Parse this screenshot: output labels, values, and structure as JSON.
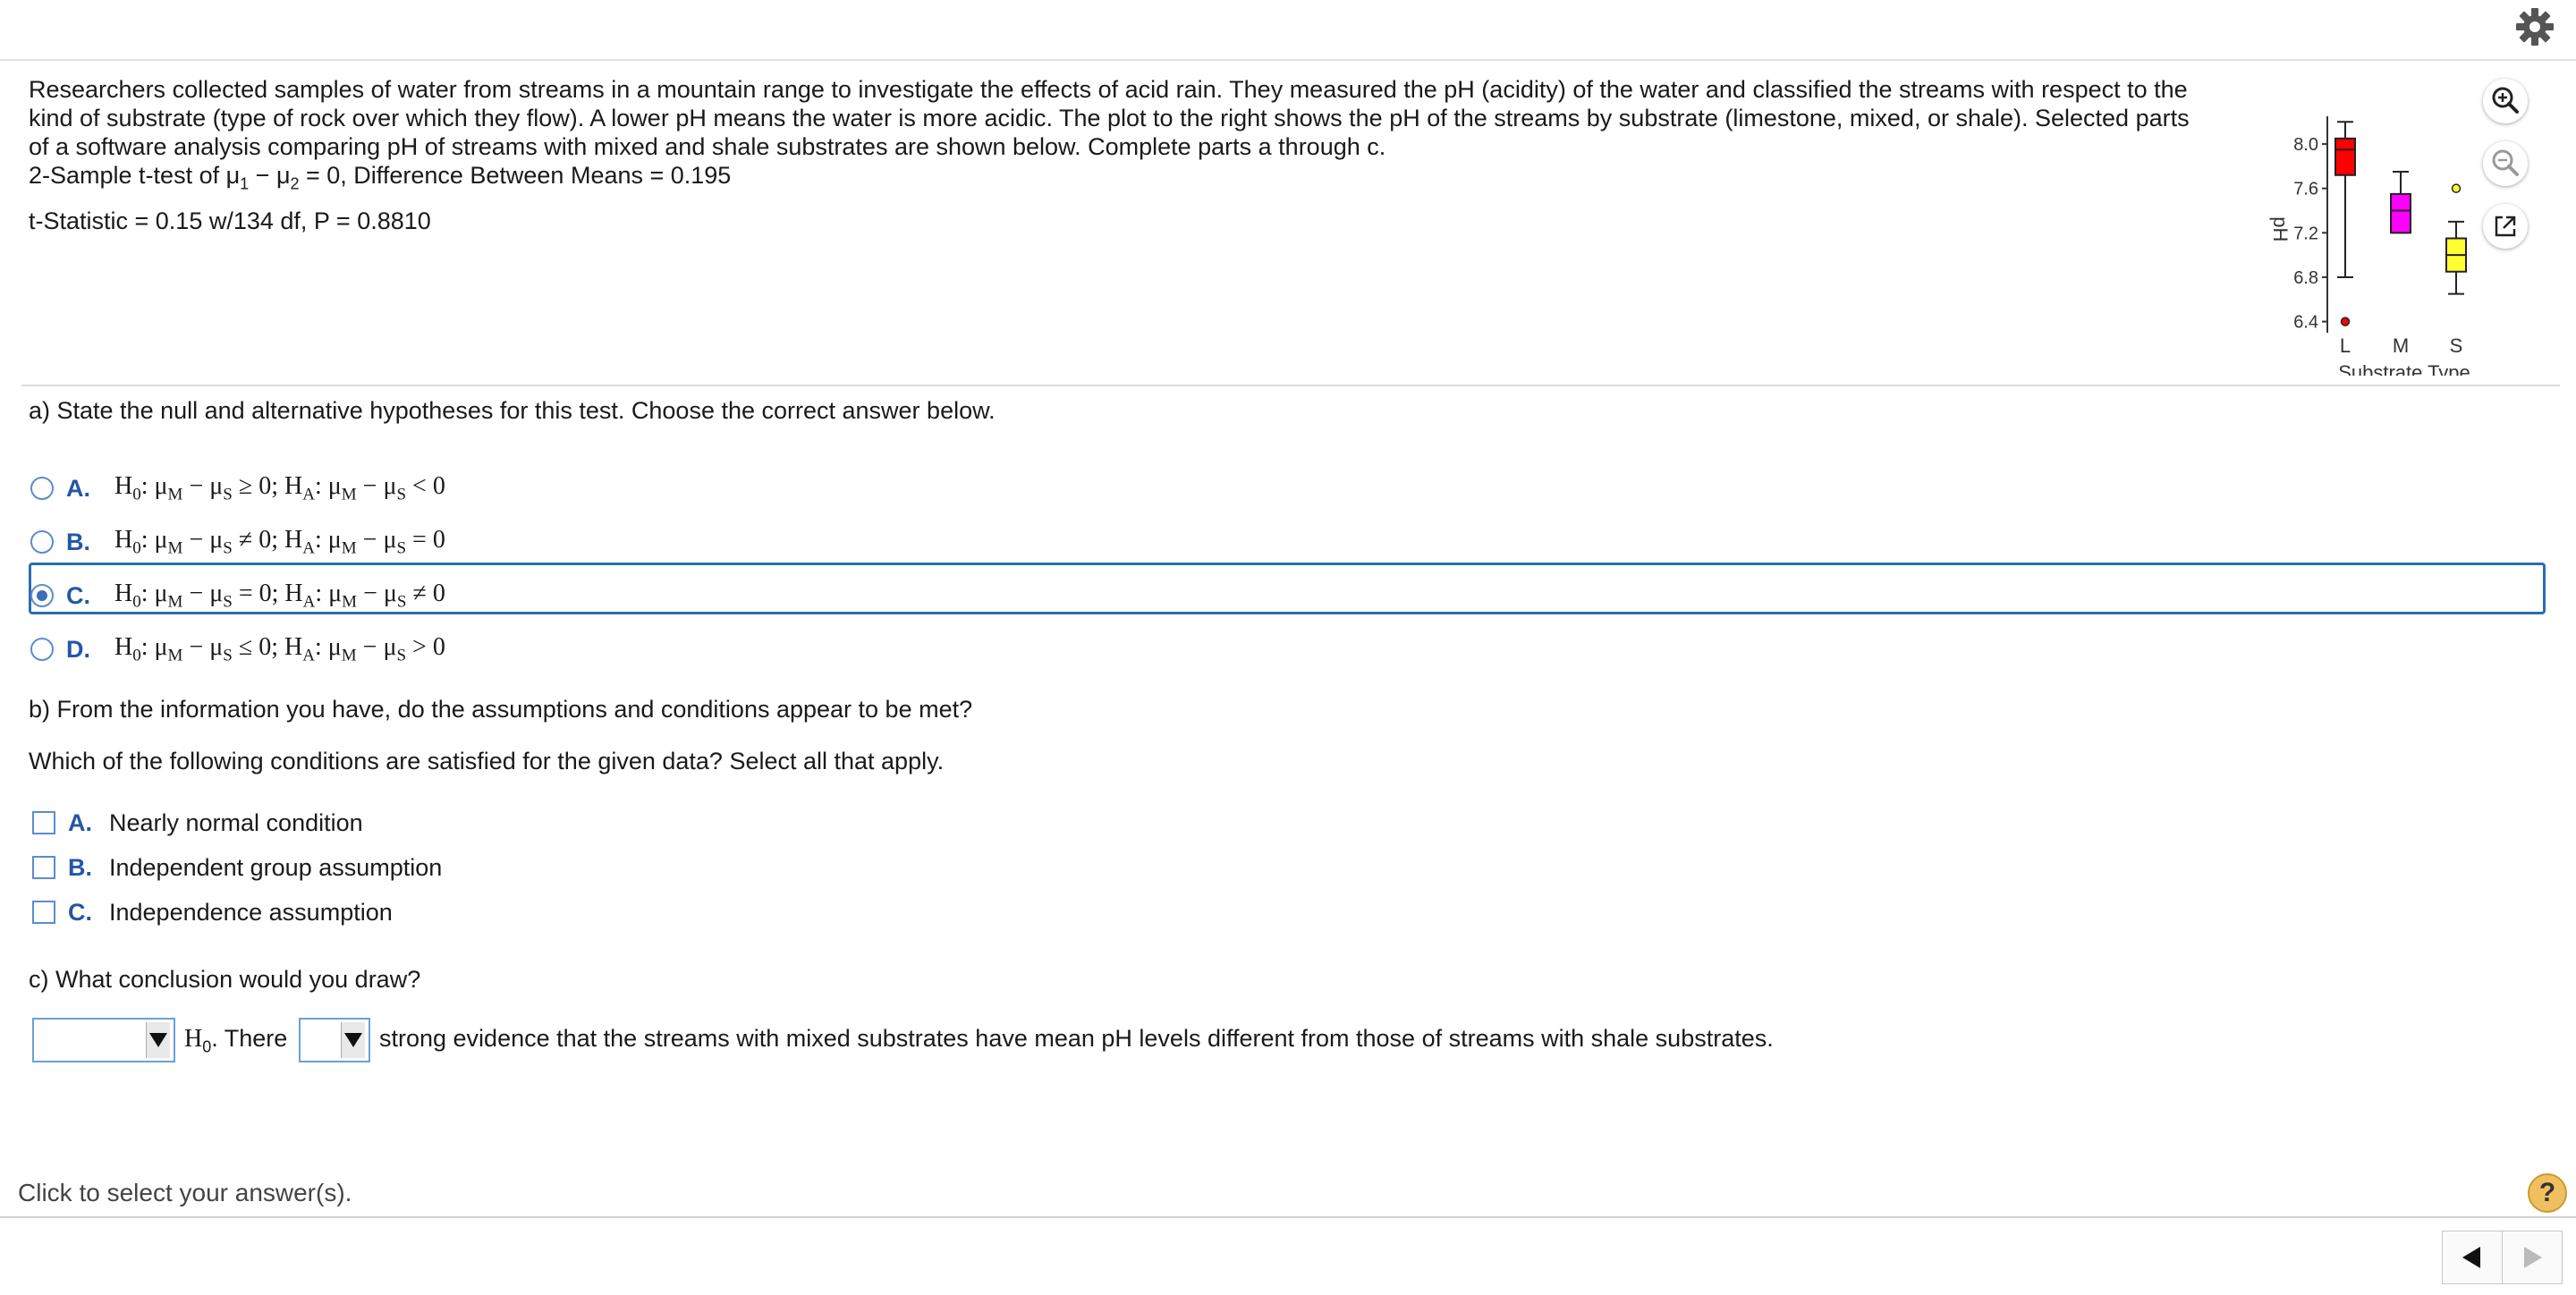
{
  "problem": {
    "paragraph": "Researchers collected samples of water from streams in a mountain range to investigate the effects of acid rain. They measured the pH (acidity) of the water and classified the streams with respect to the kind of substrate (type of rock over which they flow). A lower pH means the water is more acidic. The plot to the right shows the pH of the streams by substrate (limestone, mixed, or shale). Selected parts of a software analysis comparing pH of streams with mixed and shale substrates are shown below. Complete parts a through c.",
    "test_prefix": "2-Sample t-test of μ",
    "test_mid": " − μ",
    "test_suffix": " = 0,   Difference Between Means = 0.195",
    "sub1": "1",
    "sub2": "2",
    "stat_line": "t-Statistic = 0.15 w/134 df,   P = 0.8810"
  },
  "chart_data": {
    "type": "box",
    "xlabel": "Substrate Type",
    "ylabel": "pH",
    "categories": [
      "L",
      "M",
      "S"
    ],
    "yticks": [
      "8.0",
      "7.6",
      "7.2",
      "6.8",
      "6.4"
    ],
    "ylim": [
      6.3,
      8.25
    ],
    "series": [
      {
        "name": "L",
        "color": "#ff0000",
        "whisker_low": 6.8,
        "q1": 7.72,
        "median": 7.95,
        "q3": 8.05,
        "whisker_high": 8.2,
        "outliers": [
          6.4
        ]
      },
      {
        "name": "M",
        "color": "#ff00ff",
        "whisker_low": 7.2,
        "q1": 7.2,
        "median": 7.4,
        "q3": 7.55,
        "whisker_high": 7.75,
        "outliers": []
      },
      {
        "name": "S",
        "color": "#ffff33",
        "whisker_low": 6.65,
        "q1": 6.85,
        "median": 7.0,
        "q3": 7.15,
        "whisker_high": 7.3,
        "outliers": [
          7.6
        ]
      }
    ]
  },
  "part_a": {
    "question": "a) State the null and alternative hypotheses for this test. Choose the correct answer below.",
    "options": [
      {
        "letter": "A.",
        "h0_op": "≥ 0;",
        "ha_op": "< 0"
      },
      {
        "letter": "B.",
        "h0_op": "≠ 0;",
        "ha_op": "= 0"
      },
      {
        "letter": "C.",
        "h0_op": "= 0;",
        "ha_op": "≠ 0"
      },
      {
        "letter": "D.",
        "h0_op": "≤ 0;",
        "ha_op": "> 0"
      }
    ],
    "h_text": "H",
    "h0_sub": "0",
    "ha_sub": "A",
    "mu_text": ": μ",
    "m_sub": "M",
    "minus_mu": " − μ",
    "s_sub": "S",
    "selected": "C"
  },
  "part_b": {
    "question": "b) From the information you have, do the assumptions and conditions appear to be met?",
    "prompt": "Which of the following conditions are satisfied for the given data? Select all that apply.",
    "options": [
      {
        "letter": "A.",
        "label": "Nearly normal condition"
      },
      {
        "letter": "B.",
        "label": "Independent group assumption"
      },
      {
        "letter": "C.",
        "label": "Independence assumption"
      }
    ]
  },
  "part_c": {
    "question": "c) What conclusion would you draw?",
    "h_text": "H",
    "h_sub": "0",
    "mid_text": ". There",
    "tail_text": "strong evidence that the streams with mixed substrates have mean pH levels different from those of streams with shale substrates."
  },
  "footer": {
    "instruction": "Click to select your answer(s).",
    "help": "?"
  },
  "icons": {
    "settings": "gear-icon",
    "zoom_in": "zoom-in-icon",
    "zoom_out": "zoom-out-icon",
    "popout": "external-link-icon",
    "prev": "triangle-left-icon",
    "next": "triangle-right-icon"
  }
}
